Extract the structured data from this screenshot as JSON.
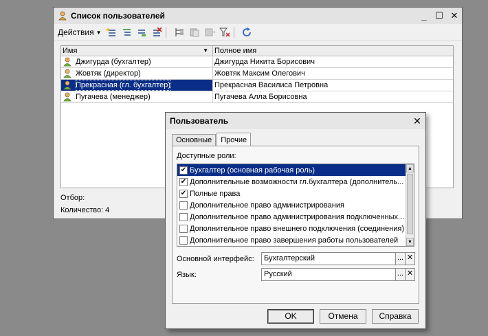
{
  "list_window": {
    "title": "Список пользователей",
    "controls": {
      "minimize": "_",
      "maximize": "☐",
      "close": "✕"
    },
    "toolbar": {
      "actions_label": "Действия"
    },
    "columns": {
      "name": "Имя",
      "full_name": "Полное имя"
    },
    "rows": [
      {
        "name": "Джигурда (бухгалтер)",
        "full_name": "Джигурда Никита Борисович"
      },
      {
        "name": "Жовтяк (директор)",
        "full_name": "Жовтяк Максим Олегович"
      },
      {
        "name": "Прекрасная (гл. бухгалтер)",
        "full_name": "Прекрасная Василиса Петровна",
        "selected": true
      },
      {
        "name": "Пугачева (менеджер)",
        "full_name": "Пугачева Алла Борисовна"
      }
    ],
    "filter_label": "Отбор:",
    "count_label": "Количество: 4"
  },
  "user_dialog": {
    "title": "Пользователь",
    "close": "✕",
    "tabs": [
      {
        "label": "Основные"
      },
      {
        "label": "Прочие",
        "active": true
      }
    ],
    "roles_label": "Доступные роли:",
    "roles": [
      {
        "label": "Бухгалтер (основная рабочая роль)",
        "checked": true,
        "selected": true
      },
      {
        "label": "Дополнительные возможности гл.бухгалтера (дополнитель...",
        "checked": true
      },
      {
        "label": "Полные права",
        "checked": true
      },
      {
        "label": "Дополнительное право администрирования",
        "checked": false
      },
      {
        "label": "Дополнительное право администрирования подключенных...",
        "checked": false
      },
      {
        "label": "Дополнительное право внешнего подключения (соединения)",
        "checked": false
      },
      {
        "label": "Дополнительное право завершения работы пользователей",
        "checked": false
      }
    ],
    "interface_label": "Основной интерфейс:",
    "interface_value": "Бухгалтерский",
    "language_label": "Язык:",
    "language_value": "Русский",
    "choose_button": "...",
    "clear_button": "✕",
    "buttons": {
      "ok": "OK",
      "cancel": "Отмена",
      "help": "Справка"
    }
  },
  "colors": {
    "selection": "#0a2d87",
    "background": "#8a8a8a"
  }
}
